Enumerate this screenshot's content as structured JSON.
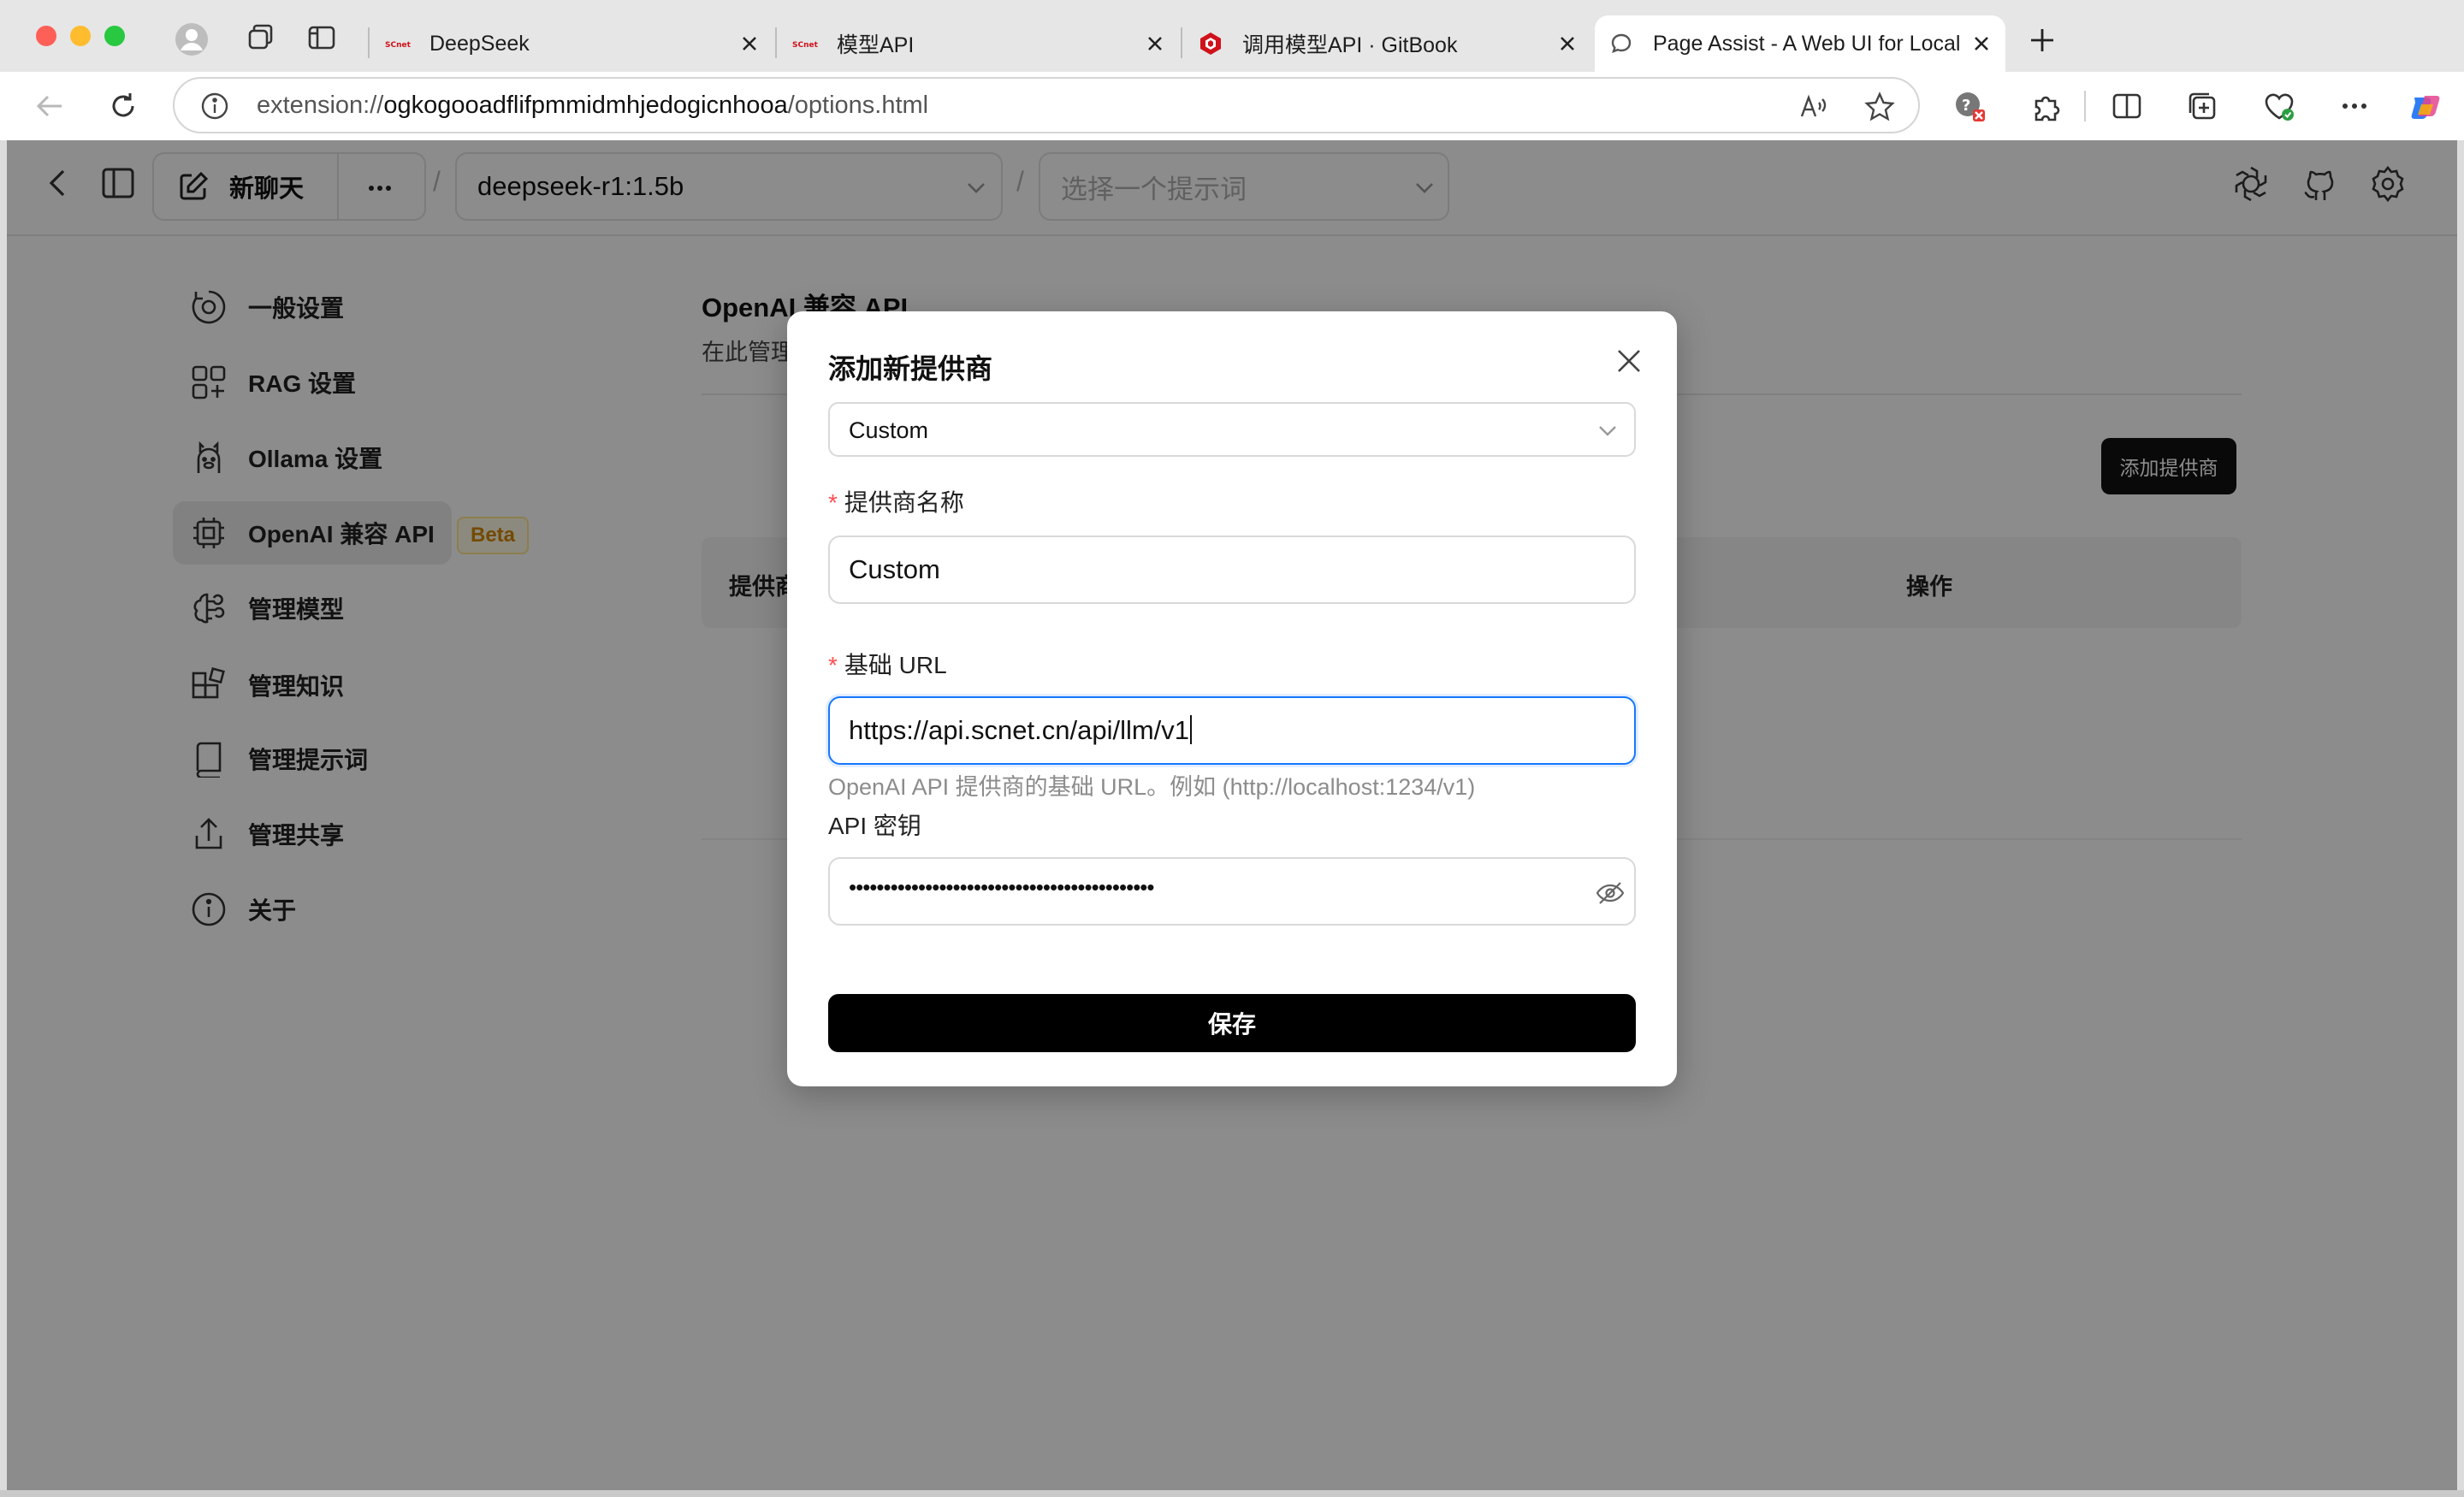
{
  "browser": {
    "tabs": [
      {
        "title": "DeepSeek",
        "favicon": "scnet-logo"
      },
      {
        "title": "模型API",
        "favicon": "scnet-logo"
      },
      {
        "title": "调用模型API · GitBook",
        "favicon": "gitbook-logo"
      },
      {
        "title": "Page Assist - A Web UI for Local AI",
        "favicon": "chat-bubble-icon"
      }
    ],
    "address": {
      "scheme": "extension://",
      "host": "ogkogooadflifpmmidmhjedogicnhooa",
      "path": "/options.html"
    },
    "scnet_badge": "SCnet"
  },
  "header": {
    "new_chat_label": "新聊天",
    "model_select_value": "deepseek-r1:1.5b",
    "prompt_select_placeholder": "选择一个提示词",
    "breadcrumb_separator": "/"
  },
  "sidebar": {
    "items": [
      {
        "label": "一般设置",
        "icon": "settings-cog-icon"
      },
      {
        "label": "RAG 设置",
        "icon": "rag-icon"
      },
      {
        "label": "Ollama 设置",
        "icon": "ollama-icon"
      },
      {
        "label": "OpenAI 兼容 API",
        "icon": "cpu-chip-icon",
        "active": true
      },
      {
        "label": "管理模型",
        "icon": "brain-icon"
      },
      {
        "label": "管理知识",
        "icon": "blocks-icon"
      },
      {
        "label": "管理提示词",
        "icon": "book-icon"
      },
      {
        "label": "管理共享",
        "icon": "share-upload-icon"
      },
      {
        "label": "关于",
        "icon": "info-icon"
      }
    ],
    "beta_badge": "Beta"
  },
  "content": {
    "title": "OpenAI 兼容 API",
    "description_visible": "在此管理",
    "add_provider_button": "添加提供商",
    "table_headers": [
      "提供商",
      "操作"
    ]
  },
  "modal": {
    "title": "添加新提供商",
    "provider_select_value": "Custom",
    "name_label": "提供商名称",
    "name_value": "Custom",
    "url_label": "基础 URL",
    "url_value": "https://api.scnet.cn/api/llm/v1",
    "url_help": "OpenAI API 提供商的基础 URL。例如 (http://localhost:1234/v1)",
    "key_label": "API 密钥",
    "key_masked": "••••••••••••••••••••••••••••••••••••••••••••",
    "save_button": "保存",
    "required_mark": "*"
  },
  "colors": {
    "accent_focus": "#1677ff",
    "required": "#ff4d4f",
    "primary_button": "#000000",
    "beta_badge_bg": "#fffbe6",
    "beta_badge_text": "#d48806",
    "overlay": "rgba(0,0,0,0.45)"
  }
}
